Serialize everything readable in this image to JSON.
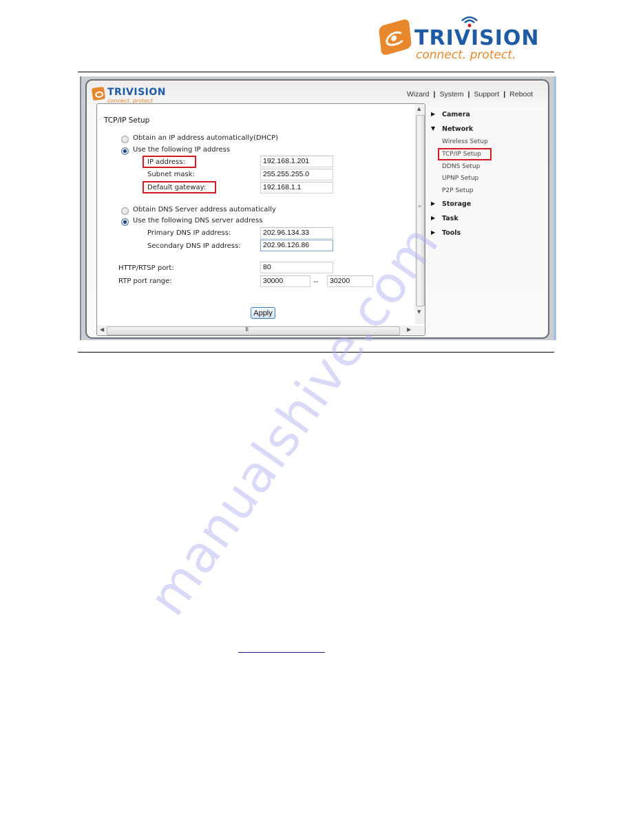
{
  "page_header": {
    "brand": "TRIVISION",
    "tagline": "connect. protect.",
    "brand_color": "#1d5ba4",
    "accent_color": "#e8872c"
  },
  "app": {
    "brand": "TRIVISION",
    "tagline": "connect. protect",
    "topnav": [
      {
        "label": "Wizard"
      },
      {
        "label": "System"
      },
      {
        "label": "Support"
      },
      {
        "label": "Reboot"
      }
    ],
    "separator": "|"
  },
  "form": {
    "title": "TCP/IP Setup",
    "ip_mode": {
      "dhcp_label": "Obtain an IP address automatically(DHCP)",
      "static_label": "Use the following IP address",
      "selected": "static"
    },
    "ip_address": {
      "label": "IP address:",
      "value": "192.168.1.201"
    },
    "subnet_mask": {
      "label": "Subnet mask:",
      "value": "255.255.255.0"
    },
    "default_gateway": {
      "label": "Default gateway:",
      "value": "192.168.1.1"
    },
    "dns_mode": {
      "auto_label": "Obtain DNS Server address automatically",
      "manual_label": "Use the following DNS server address",
      "selected": "manual"
    },
    "primary_dns": {
      "label": "Primary DNS IP address:",
      "value": "202.96.134.33"
    },
    "secondary_dns": {
      "label": "Secondary DNS IP address:",
      "value": "202.96.126.86"
    },
    "http_port": {
      "label": "HTTP/RTSP port:",
      "value": "80"
    },
    "rtp_range": {
      "label": "RTP port range:",
      "from": "30000",
      "separator": "--",
      "to": "30200"
    },
    "apply_label": "Apply",
    "highlight_color": "#d71920"
  },
  "sidebar": {
    "categories": [
      {
        "label": "Camera",
        "expanded": false
      },
      {
        "label": "Network",
        "expanded": true,
        "items": [
          {
            "label": "Wireless Setup"
          },
          {
            "label": "TCP/IP Setup",
            "active": true
          },
          {
            "label": "DDNS Setup"
          },
          {
            "label": "UPNP Setup"
          },
          {
            "label": "P2P Setup"
          }
        ]
      },
      {
        "label": "Storage",
        "expanded": false
      },
      {
        "label": "Task",
        "expanded": false
      },
      {
        "label": "Tools",
        "expanded": false
      }
    ]
  },
  "scrollbars": {
    "up": "▲",
    "down": "▼",
    "left": "◀",
    "right": "▶",
    "grip_v": "≡",
    "grip_h": "III"
  },
  "icons": {
    "collapsed": "▶",
    "expanded": "▼"
  },
  "watermark": "manualshive.com"
}
